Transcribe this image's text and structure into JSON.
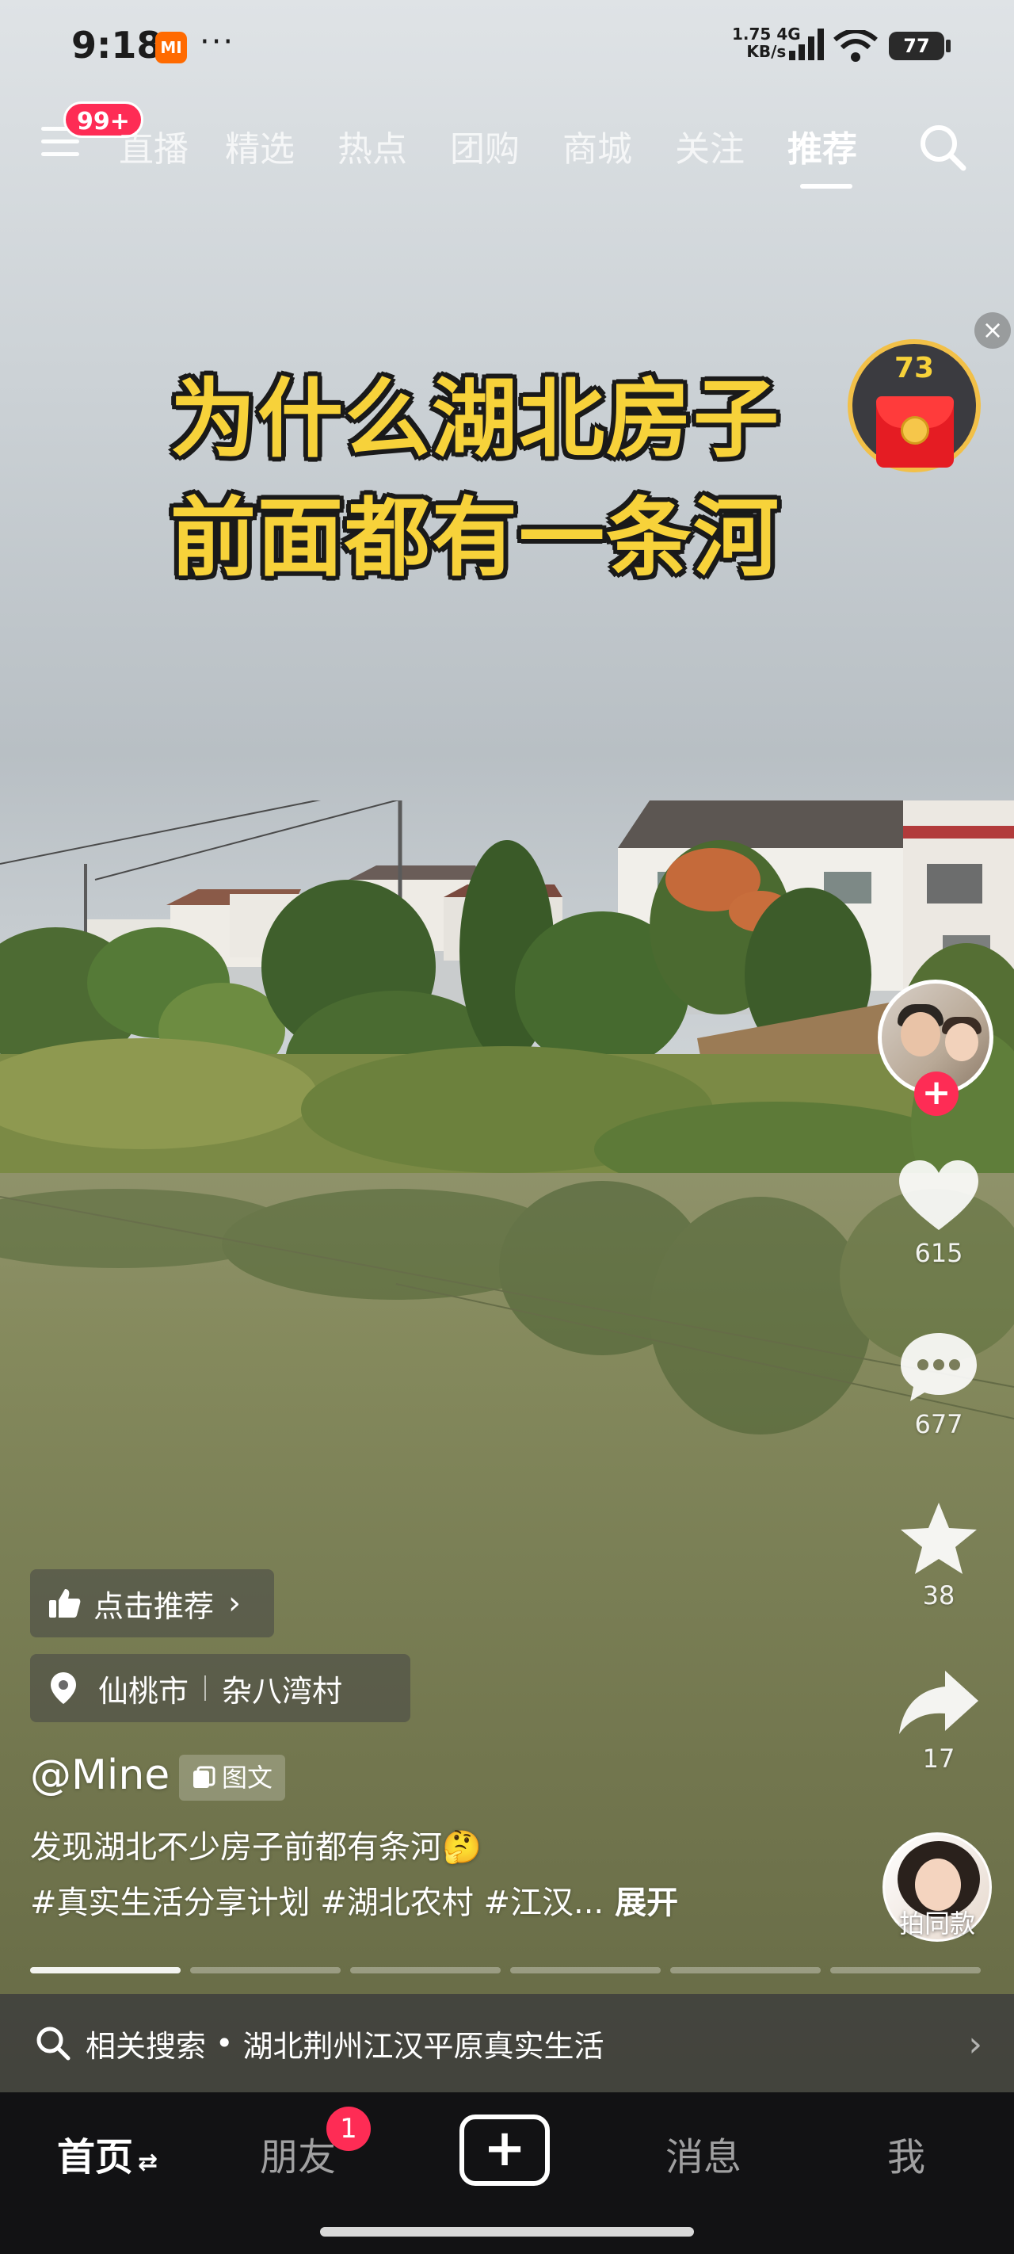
{
  "status_bar": {
    "time": "9:18",
    "mi_label": "MI",
    "more": "···",
    "net_speed_value": "1.75",
    "net_speed_unit": "KB/s",
    "network": "4G",
    "battery": "77"
  },
  "top_nav": {
    "menu_badge": "99+",
    "tabs": [
      {
        "label": "直播"
      },
      {
        "label": "精选"
      },
      {
        "label": "热点"
      },
      {
        "label": "团购"
      },
      {
        "label": "商城"
      },
      {
        "label": "关注"
      },
      {
        "label": "推荐",
        "active": true
      }
    ]
  },
  "headline": {
    "line1": "为什么湖北房子",
    "line2": "前面都有一条河"
  },
  "red_packet": {
    "close": "×",
    "count": "73"
  },
  "actions": {
    "follow": "+",
    "likes": "615",
    "comments": "677",
    "favorites": "38",
    "shares": "17",
    "same_style": "拍同款"
  },
  "post": {
    "recommend_chip": "点击推荐",
    "location_city": "仙桃市",
    "location_place": "杂八湾村",
    "author": "@Mine",
    "type_tag": "图文",
    "description": "发现湖北不少房子前都有条河🤔",
    "hashtags": "#真实生活分享计划 #湖北农村 #江汉...",
    "expand": "展开",
    "progress_segments": 6,
    "progress_active_index": 0
  },
  "related_search": {
    "prefix": "相关搜索",
    "dot": "•",
    "query": "湖北荆州江汉平原真实生活"
  },
  "bottom_nav": {
    "home": "首页",
    "home_switch": "⇄",
    "friends": "朋友",
    "friends_badge": "1",
    "create": "+",
    "messages": "消息",
    "me": "我"
  },
  "colors": {
    "accent_red": "#fe2c55",
    "headline_yellow": "#f7d23a",
    "bottom_bar": "#121214"
  }
}
